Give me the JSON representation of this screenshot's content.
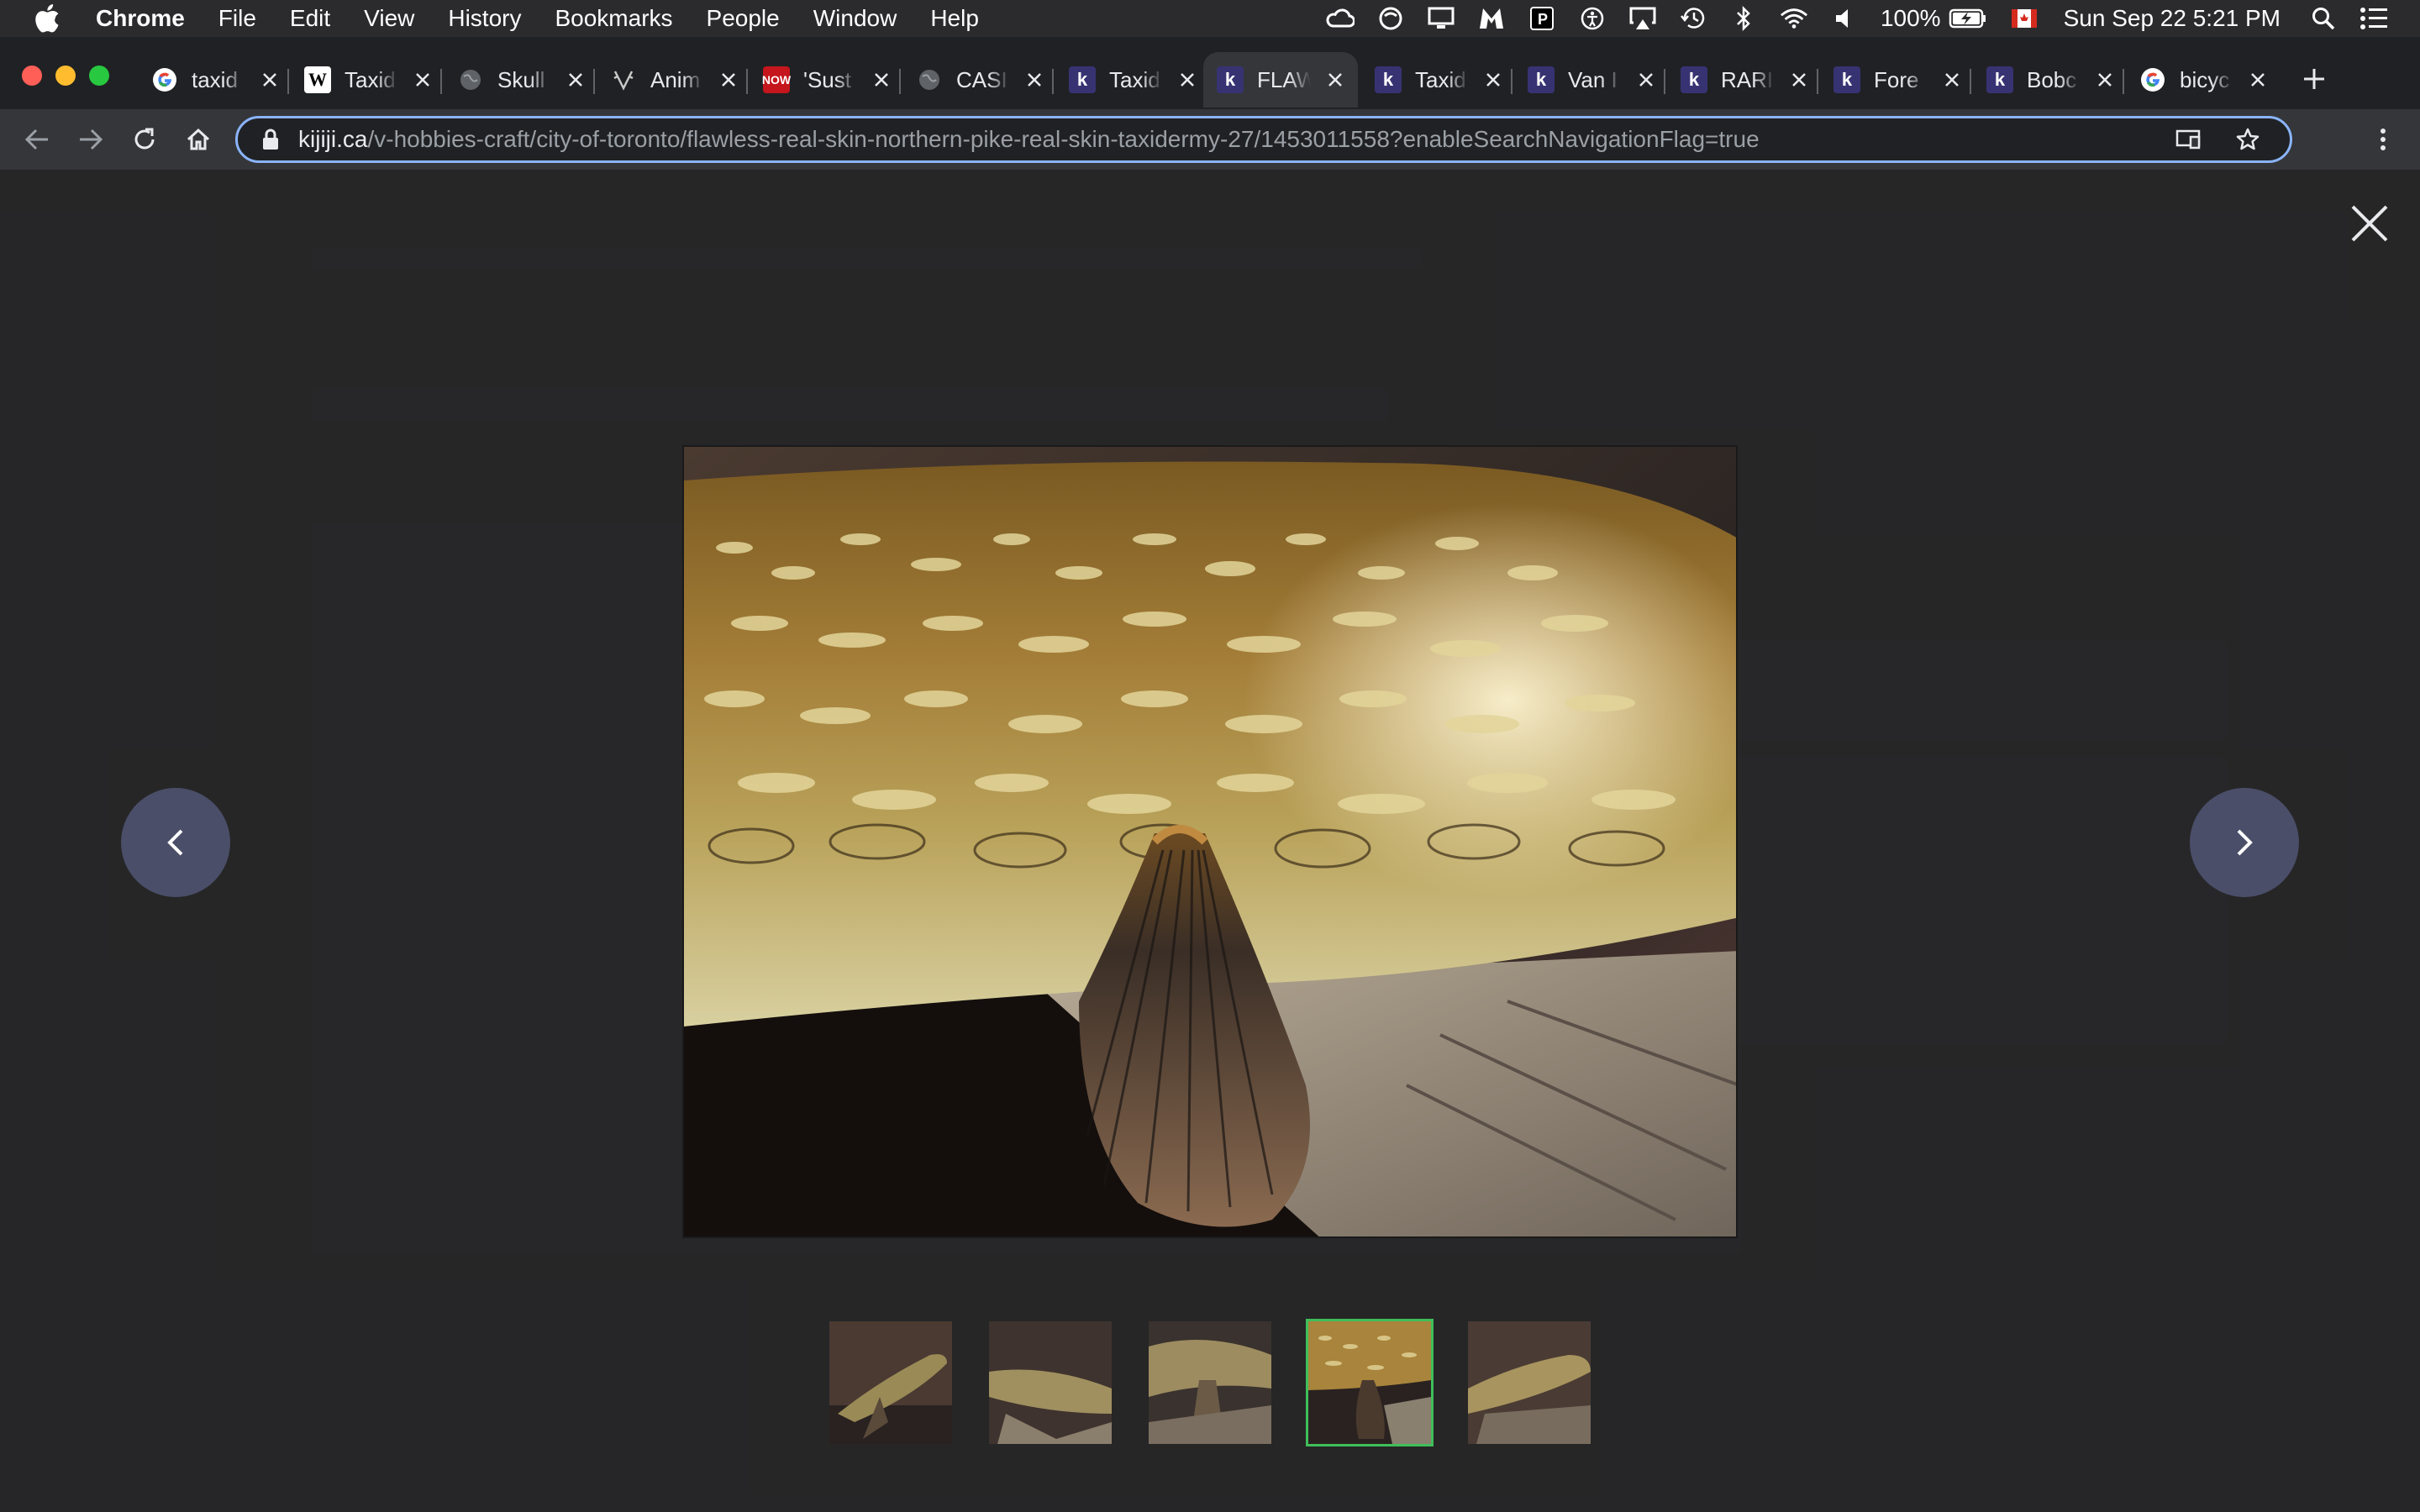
{
  "menubar": {
    "app_name": "Chrome",
    "menus": [
      "File",
      "Edit",
      "View",
      "History",
      "Bookmarks",
      "People",
      "Window",
      "Help"
    ],
    "battery": "100%",
    "datetime": "Sun Sep 22  5:21 PM"
  },
  "tabs": [
    {
      "title": "taxid",
      "favicon": "google-icon"
    },
    {
      "title": "Taxid",
      "favicon": "wikipedia-icon"
    },
    {
      "title": "Skull",
      "favicon": "globe-icon"
    },
    {
      "title": "Anim",
      "favicon": "antler-icon"
    },
    {
      "title": "'Sust",
      "favicon": "now-icon"
    },
    {
      "title": "CASI",
      "favicon": "globe-icon"
    },
    {
      "title": "Taxid",
      "favicon": "kijiji-icon"
    },
    {
      "title": "FLAW",
      "favicon": "kijiji-icon",
      "active": true
    },
    {
      "title": "Taxid",
      "favicon": "kijiji-icon"
    },
    {
      "title": "Van I",
      "favicon": "kijiji-icon"
    },
    {
      "title": "RARI",
      "favicon": "kijiji-icon"
    },
    {
      "title": "Fore",
      "favicon": "kijiji-icon"
    },
    {
      "title": "Bobc",
      "favicon": "kijiji-icon"
    },
    {
      "title": "bicyc",
      "favicon": "google-icon"
    }
  ],
  "address": {
    "host": "kijiji.ca",
    "path": "/v-hobbies-craft/city-of-toronto/flawless-real-skin-northern-pike-real-skin-taxidermy-27/1453011558?enableSearchNavigationFlag=true"
  },
  "gallery": {
    "selected_index": 3,
    "thumbnail_count": 5
  },
  "colors": {
    "accent_focus": "#8ab4f8",
    "selected_thumb_border": "#3fbf5a",
    "nav_button": "#4a4e68",
    "kijiji_favicon": "#373373"
  }
}
